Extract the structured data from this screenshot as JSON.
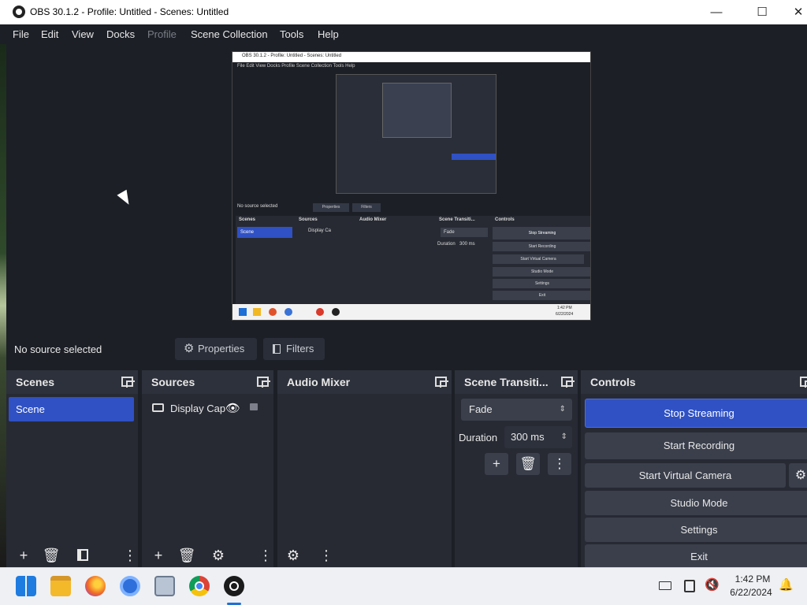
{
  "window": {
    "title": "OBS 30.1.2 - Profile: Untitled - Scenes: Untitled",
    "minimize": "—",
    "maximize": "☐",
    "close": "✕"
  },
  "menu": [
    {
      "label": "File",
      "enabled": true
    },
    {
      "label": "Edit",
      "enabled": true
    },
    {
      "label": "View",
      "enabled": true
    },
    {
      "label": "Docks",
      "enabled": true
    },
    {
      "label": "Profile",
      "enabled": false
    },
    {
      "label": "Scene Collection",
      "enabled": true
    },
    {
      "label": "Tools",
      "enabled": true
    },
    {
      "label": "Help",
      "enabled": true
    }
  ],
  "preview": {
    "nested_title": "OBS 30.1.2 - Profile: Untitled - Scenes: Untitled",
    "nested_menu": "File   Edit   View   Docks   Profile   Scene Collection   Tools   Help",
    "nested_status": "No source selected",
    "nested_properties": "Properties",
    "nested_filters": "Filters",
    "nested_docks": [
      "Scenes",
      "Sources",
      "Audio Mixer",
      "Scene Transiti...",
      "Controls"
    ],
    "nested_scene": "Scene",
    "nested_source": "Display Ca",
    "nested_transition": "Fade",
    "nested_duration_label": "Duration",
    "nested_duration": "300 ms",
    "nested_controls": [
      "Stop Streaming",
      "Start Recording",
      "Start Virtual Camera",
      "Studio Mode",
      "Settings",
      "Exit"
    ],
    "nested_time": "1:42 PM",
    "nested_date": "6/22/2024"
  },
  "status": {
    "selection": "No source selected",
    "properties_label": "Properties",
    "filters_label": "Filters"
  },
  "docks": {
    "scenes": {
      "title": "Scenes",
      "items": [
        "Scene"
      ]
    },
    "sources": {
      "title": "Sources",
      "items": [
        {
          "name": "Display Cap"
        }
      ]
    },
    "audio_mixer": {
      "title": "Audio Mixer"
    },
    "transitions": {
      "title": "Scene Transiti...",
      "transition": "Fade",
      "duration_label": "Duration",
      "duration": "300 ms"
    },
    "controls": {
      "title": "Controls",
      "stop_streaming": "Stop Streaming",
      "start_recording": "Start Recording",
      "start_virtual_camera": "Start Virtual Camera",
      "studio_mode": "Studio Mode",
      "settings": "Settings",
      "exit": "Exit"
    }
  },
  "taskbar": {
    "time": "1:42 PM",
    "date": "6/22/2024",
    "apps": [
      "windows-start",
      "file-explorer",
      "firefox",
      "chromium",
      "app-installer",
      "chrome",
      "obs-studio"
    ]
  },
  "colors": {
    "accent": "#2f51c4",
    "background": "#1c1f26",
    "dock": "#272a33",
    "button": "#3a3f4b"
  }
}
